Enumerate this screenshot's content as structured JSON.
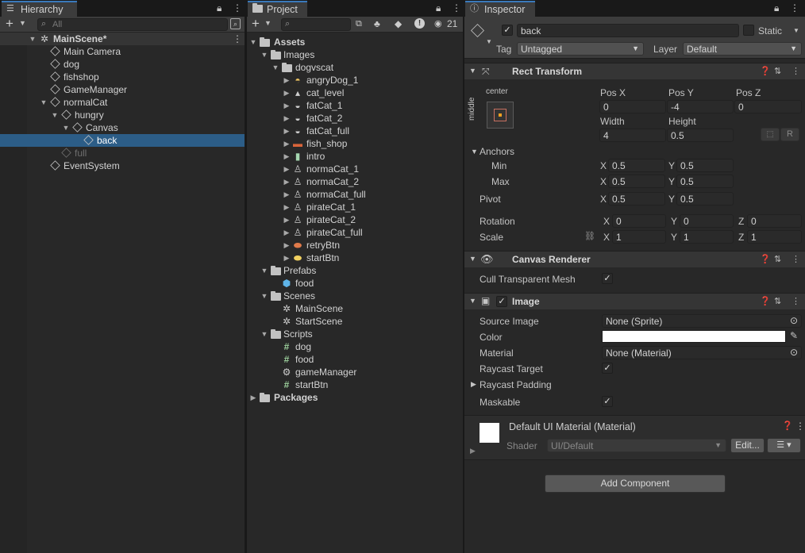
{
  "hierarchy": {
    "tab": "Hierarchy",
    "search_placeholder": "All",
    "scene": "MainScene*",
    "items": [
      {
        "label": "Main Camera",
        "depth": 1
      },
      {
        "label": "dog",
        "depth": 1
      },
      {
        "label": "fishshop",
        "depth": 1
      },
      {
        "label": "GameManager",
        "depth": 1
      },
      {
        "label": "normalCat",
        "depth": 1
      },
      {
        "label": "hungry",
        "depth": 2
      },
      {
        "label": "Canvas",
        "depth": 3
      },
      {
        "label": "back",
        "depth": 4
      },
      {
        "label": "full",
        "depth": 2
      },
      {
        "label": "EventSystem",
        "depth": 1
      }
    ]
  },
  "project": {
    "tab": "Project",
    "hidden_count": "21",
    "tree": {
      "assets": "Assets",
      "images": "Images",
      "dogvscat": "dogvscat",
      "sprites": [
        "angryDog_1",
        "cat_level",
        "fatCat_1",
        "fatCat_2",
        "fatCat_full",
        "fish_shop",
        "intro",
        "normaCat_1",
        "normaCat_2",
        "normaCat_full",
        "pirateCat_1",
        "pirateCat_2",
        "pirateCat_full",
        "retryBtn",
        "startBtn"
      ],
      "prefabs": "Prefabs",
      "prefab_items": [
        "food"
      ],
      "scenes": "Scenes",
      "scene_items": [
        "MainScene",
        "StartScene"
      ],
      "scripts": "Scripts",
      "script_items": [
        "dog",
        "food",
        "gameManager",
        "startBtn"
      ],
      "packages": "Packages"
    }
  },
  "inspector": {
    "tab": "Inspector",
    "name": "back",
    "static": "Static",
    "tag_label": "Tag",
    "tag": "Untagged",
    "layer_label": "Layer",
    "layer": "Default",
    "rect_transform": {
      "title": "Rect Transform",
      "anchor_h": "center",
      "anchor_v": "middle",
      "pos_x_label": "Pos X",
      "pos_y_label": "Pos Y",
      "pos_z_label": "Pos Z",
      "pos_x": "0",
      "pos_y": "-4",
      "pos_z": "0",
      "width_label": "Width",
      "height_label": "Height",
      "width": "4",
      "height": "0.5",
      "r_btn": "R",
      "anchors_label": "Anchors",
      "min_label": "Min",
      "max_label": "Max",
      "min_x": "0.5",
      "min_y": "0.5",
      "max_x": "0.5",
      "max_y": "0.5",
      "pivot_label": "Pivot",
      "pivot_x": "0.5",
      "pivot_y": "0.5",
      "rotation_label": "Rotation",
      "rot_x": "0",
      "rot_y": "0",
      "rot_z": "0",
      "scale_label": "Scale",
      "scale_x": "1",
      "scale_y": "1",
      "scale_z": "1",
      "x": "X",
      "y": "Y",
      "z": "Z"
    },
    "canvas_renderer": {
      "title": "Canvas Renderer",
      "cull_label": "Cull Transparent Mesh"
    },
    "image": {
      "title": "Image",
      "source_label": "Source Image",
      "source": "None (Sprite)",
      "color_label": "Color",
      "material_label": "Material",
      "material": "None (Material)",
      "raycast_label": "Raycast Target",
      "raycast_padding_label": "Raycast Padding",
      "maskable_label": "Maskable"
    },
    "material": {
      "title": "Default UI Material (Material)",
      "shader_label": "Shader",
      "shader": "UI/Default",
      "edit_btn": "Edit..."
    },
    "add_component": "Add Component"
  },
  "colors": {
    "selection": "#2c5d87",
    "accent_tab": "#3a79bb",
    "panel": "#282828"
  }
}
